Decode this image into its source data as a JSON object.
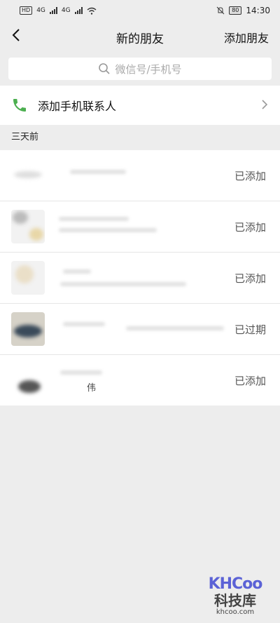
{
  "status_bar": {
    "hd_label": "HD",
    "net_1": "4G",
    "net_2": "4G",
    "battery": "80",
    "time": "14:30"
  },
  "nav": {
    "title": "新的朋友",
    "action_label": "添加朋友"
  },
  "search": {
    "placeholder": "微信号/手机号"
  },
  "contacts": {
    "label": "添加手机联系人"
  },
  "section": {
    "label": "三天前"
  },
  "requests": [
    {
      "status": "已添加",
      "sub": ""
    },
    {
      "status": "已添加",
      "sub": ""
    },
    {
      "status": "已添加",
      "sub": ""
    },
    {
      "status": "已过期",
      "sub": ""
    },
    {
      "status": "已添加",
      "sub": "伟"
    }
  ],
  "watermark": {
    "logo": "KHCoo",
    "cn": "科技库",
    "url": "khcoo.com"
  },
  "colors": {
    "background": "#ededed",
    "phone_icon": "#4caf50",
    "watermark_logo": "#5b62d6"
  }
}
